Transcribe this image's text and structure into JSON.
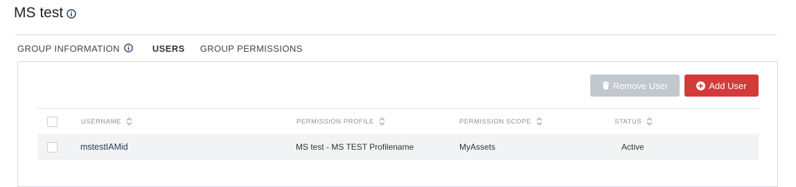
{
  "page": {
    "title": "MS test"
  },
  "tabs": [
    {
      "label": "GROUP INFORMATION"
    },
    {
      "label": "USERS"
    },
    {
      "label": "GROUP PERMISSIONS"
    }
  ],
  "actions": {
    "remove_label": "Remove User",
    "add_label": "Add User"
  },
  "table": {
    "columns": [
      "USERNAME",
      "PERMISSION PROFILE",
      "PERMISSION SCOPE",
      "STATUS"
    ],
    "rows": [
      {
        "username": "mstestIAMid",
        "permission_profile": "MS test - MS TEST Profilename",
        "permission_scope": "MyAssets",
        "status": "Active"
      }
    ]
  },
  "colors": {
    "accent": "#d43a3a",
    "disabled": "#c2c8cf",
    "row_bg": "#f2f3f5"
  }
}
